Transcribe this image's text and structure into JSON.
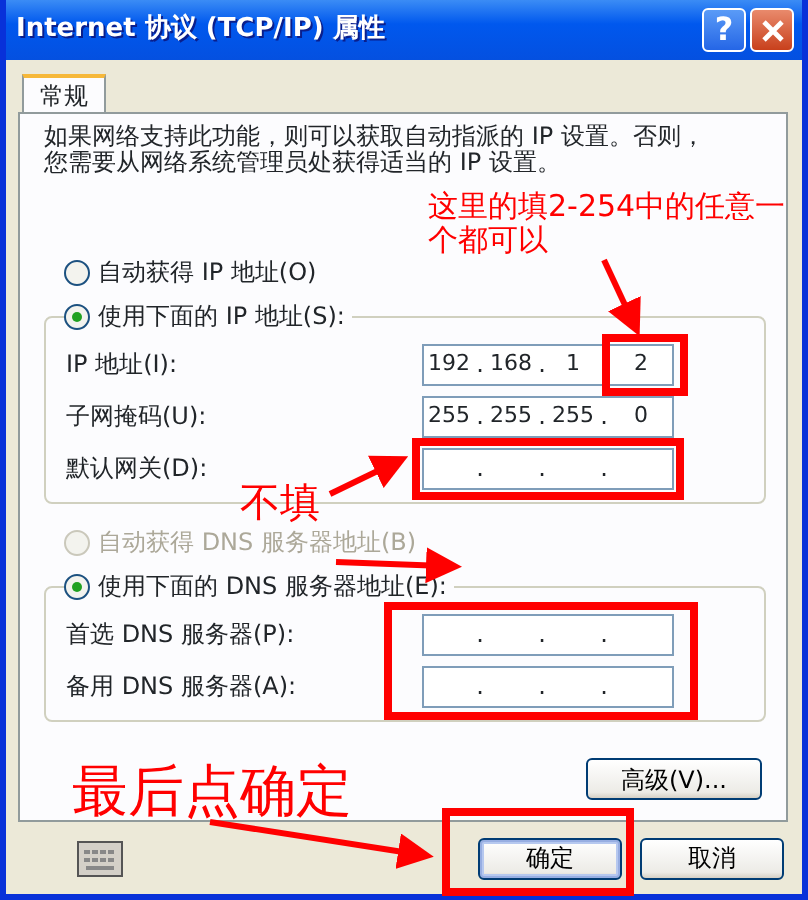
{
  "window": {
    "title": "Internet 协议 (TCP/IP) 属性",
    "help_button": "?"
  },
  "tabs": [
    {
      "label": "常规",
      "selected": true
    }
  ],
  "description_lines": [
    "如果网络支持此功能，则可以获取自动指派的 IP 设置。否则，",
    "您需要从网络系统管理员处获得适当的 IP 设置。"
  ],
  "separator": ".",
  "ip_mode": [
    {
      "label": "自动获得 IP 地址(O)",
      "selected": false,
      "disabled": false
    },
    {
      "label": "使用下面的 IP 地址(S):",
      "selected": true,
      "disabled": false
    }
  ],
  "ip_fields": [
    {
      "label": "IP 地址(I):",
      "octets": [
        "192",
        "168",
        "1",
        "2"
      ]
    },
    {
      "label": "子网掩码(U):",
      "octets": [
        "255",
        "255",
        "255",
        "0"
      ]
    },
    {
      "label": "默认网关(D):"
    }
  ],
  "dns_mode": [
    {
      "label": "自动获得 DNS 服务器地址(B)",
      "selected": false,
      "disabled": true
    },
    {
      "label": "使用下面的 DNS 服务器地址(E):",
      "selected": true,
      "disabled": false
    }
  ],
  "dns_fields": [
    {
      "label": "首选 DNS 服务器(P):"
    },
    {
      "label": "备用 DNS 服务器(A):"
    }
  ],
  "advanced_button": "高级(V)...",
  "buttons": [
    {
      "label": "确定",
      "default": true
    },
    {
      "label": "取消",
      "default": false
    }
  ],
  "annotations": {
    "ip_note": [
      "这里的填2-254中的任意一",
      "个都可以"
    ],
    "skip_note": "不填",
    "ok_note": "最后点确定"
  }
}
